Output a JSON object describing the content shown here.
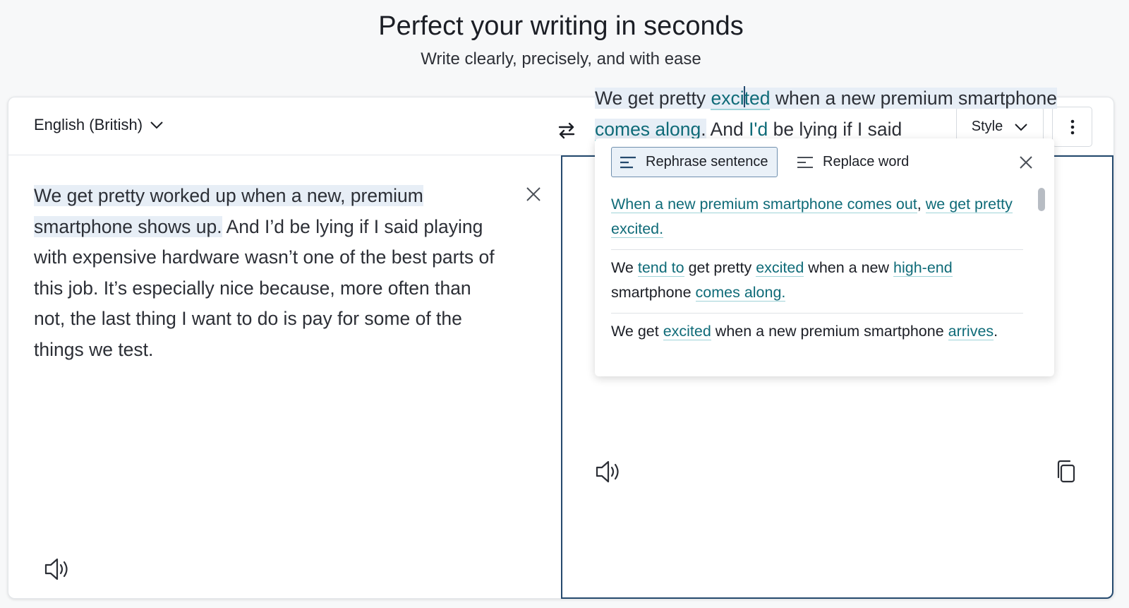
{
  "hero": {
    "title": "Perfect your writing in seconds",
    "subtitle": "Write clearly, precisely, and with ease"
  },
  "toolbar": {
    "language": "English (British)",
    "language_icon": "chevron-down-icon",
    "swap_icon": "swap-arrows-icon",
    "style_label": "Style",
    "more_icon": "vertical-dots-icon"
  },
  "source": {
    "sentence1_a": "We get pretty worked up when a new, premium",
    "sentence1_b": "smartphone shows up.",
    "rest": " And I’d be lying if I said playing with expensive hardware wasn’t one of the best parts of this job. It’s especially nice because, more often than not, the last thing I want to do is pay for some of the things we test."
  },
  "target": {
    "p1": "We get pretty ",
    "w1a": "exci",
    "w1b": "ted",
    "p2": " when a new premium smartphone ",
    "w2": "comes along",
    "p3": ".",
    "p4": " And ",
    "w3": "I'd",
    "p5": " be lying if I said"
  },
  "popup": {
    "tab_rephrase": "Rephrase sentence",
    "tab_replace": "Replace word",
    "alternatives": [
      [
        {
          "t": "When a new premium smartphone comes out",
          "c": true
        },
        {
          "t": ", ",
          "c": false
        },
        {
          "t": "we get pretty excited.",
          "c": true
        }
      ],
      [
        {
          "t": "We ",
          "c": false
        },
        {
          "t": "tend to",
          "c": true
        },
        {
          "t": " get pretty ",
          "c": false
        },
        {
          "t": "excited",
          "c": true
        },
        {
          "t": " when a new ",
          "c": false
        },
        {
          "t": "high-end",
          "c": true
        },
        {
          "t": " smartphone ",
          "c": false
        },
        {
          "t": "comes along.",
          "c": true
        }
      ],
      [
        {
          "t": "We get ",
          "c": false
        },
        {
          "t": "excited",
          "c": true
        },
        {
          "t": " when a new premium smartphone ",
          "c": false
        },
        {
          "t": "arrives",
          "c": true
        },
        {
          "t": ".",
          "c": false
        }
      ]
    ]
  },
  "colors": {
    "accent": "#0f6b78",
    "highlight": "#e7eef6",
    "active_border": "#254a6e"
  }
}
